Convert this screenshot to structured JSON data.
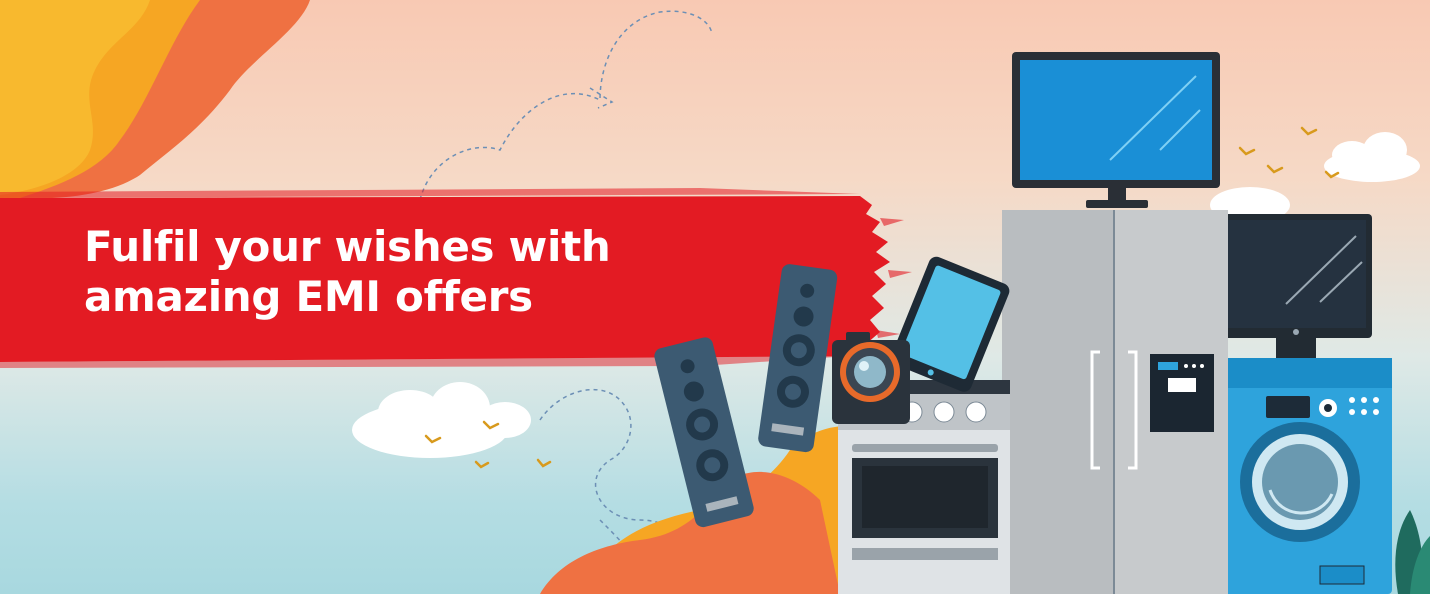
{
  "banner": {
    "headline": {
      "line1": "Fulfil your wishes with",
      "line2": "amazing EMI offers"
    }
  },
  "colors": {
    "brush_red": "#e31b23",
    "swirl_orange": "#ef7142",
    "swirl_yellow": "#f6a623",
    "appliance_dark": "#1f2933",
    "screen_blue": "#1a8fd6",
    "washer_blue": "#2ea3dc",
    "fridge_silver": "#bfc3c6",
    "cloud_white": "#ffffff",
    "bird_gold": "#d89a1d"
  },
  "illustration": {
    "items": [
      "television-icon",
      "refrigerator-icon",
      "monitor-icon",
      "washing-machine-icon",
      "cooking-range-icon",
      "camera-icon",
      "tablet-icon",
      "speaker-icon"
    ]
  }
}
